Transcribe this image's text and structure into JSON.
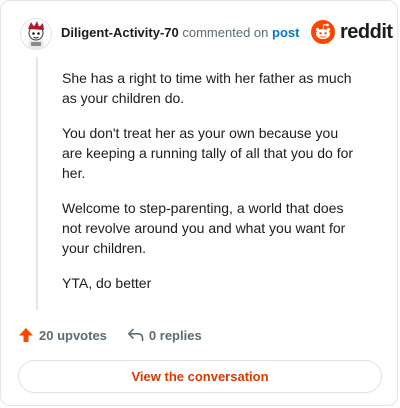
{
  "comment": {
    "username": "Diligent-Activity-70",
    "action_text": "commented on",
    "post_link": "post",
    "paragraphs": [
      "She has a right to time with her father as much as your children do.",
      "You don't treat her as your own because you are keeping a running tally of all that you do for her.",
      "Welcome to step-parenting, a world that does not revolve around you and what you want for your children.",
      "YTA, do better"
    ]
  },
  "brand": {
    "wordmark": "reddit",
    "accent": "#ff4500"
  },
  "stats": {
    "upvotes_label": "20 upvotes",
    "replies_label": "0 replies",
    "upvote_icon": "upvote-arrow-icon",
    "reply_icon": "reply-arrow-icon"
  },
  "cta": {
    "label": "View the conversation",
    "color": "#d93a00"
  }
}
